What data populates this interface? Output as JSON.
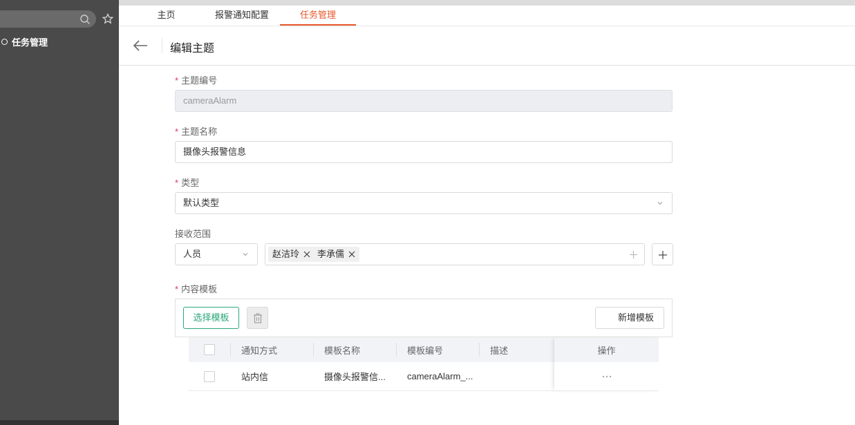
{
  "sidebar": {
    "menu_item": "任务管理"
  },
  "tabs": [
    {
      "label": "主页"
    },
    {
      "label": "报警通知配置"
    },
    {
      "label": "任务管理"
    }
  ],
  "header": {
    "title": "编辑主题"
  },
  "form": {
    "required_mark": "*",
    "topic_code": {
      "label": "主题编号",
      "value": "cameraAlarm"
    },
    "topic_name": {
      "label": "主题名称",
      "value": "摄像头报警信息"
    },
    "type": {
      "label": "类型",
      "value": "默认类型"
    },
    "receive_scope": {
      "label": "接收范围",
      "scope_type": "人员",
      "tags": [
        "赵洁玲",
        "李承儒"
      ]
    },
    "content_template": {
      "label": "内容模板",
      "select_button": "选择模板",
      "new_button": "新增模板"
    }
  },
  "table": {
    "headers": [
      "通知方式",
      "模板名称",
      "模板编号",
      "描述",
      "操作"
    ],
    "rows": [
      {
        "method": "站内信",
        "name": "摄像头报警信...",
        "code": "cameraAlarm_...",
        "desc": ""
      }
    ]
  },
  "colors": {
    "accent": "#e8562a",
    "primary_green": "#2aa77a",
    "required": "#e0336c",
    "sidebar_bg": "#4a4a4a"
  },
  "icons": [
    "search-icon",
    "star-icon",
    "back-arrow-icon",
    "chevron-down-icon",
    "close-icon",
    "plus-icon",
    "trash-icon",
    "more-icon"
  ]
}
